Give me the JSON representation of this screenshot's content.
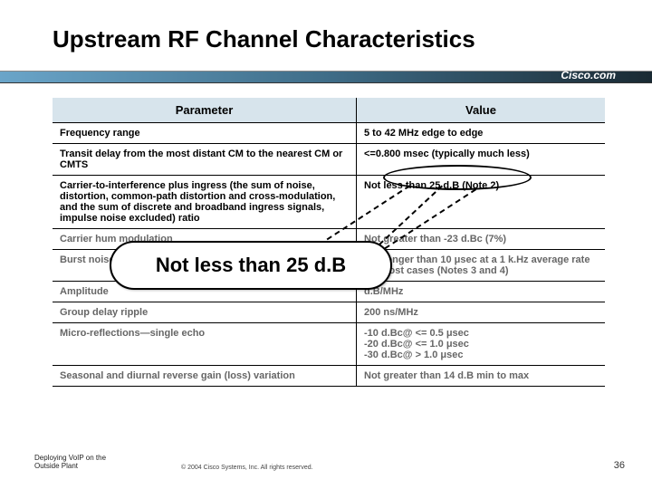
{
  "title": "Upstream RF Channel Characteristics",
  "brand": "Cisco.com",
  "table": {
    "headers": {
      "param": "Parameter",
      "value": "Value"
    },
    "rows": [
      {
        "param": "Frequency range",
        "value": "5 to 42 MHz edge to edge"
      },
      {
        "param": "Transit delay from the most distant CM to the nearest CM or CMTS",
        "value": "<=0.800 msec (typically much less)"
      },
      {
        "param": "Carrier-to-interference plus ingress (the sum of noise, distortion, common-path distortion and cross-modulation, and the sum of discrete and broadband ingress signals, impulse noise excluded) ratio",
        "value": "Not less than 25 d.B (Note 2)"
      },
      {
        "param": "Carrier hum modulation",
        "value": "Not greater than -23 d.Bc (7%)"
      },
      {
        "param": "Burst noise",
        "value": "Not longer than 10 μsec at a 1 k.Hz average rate for most cases (Notes 3 and 4)"
      },
      {
        "param": "Amplitude",
        "value": "d.B/MHz"
      },
      {
        "param": "Group delay ripple",
        "value": "200 ns/MHz"
      },
      {
        "param": "Micro-reflections—single echo",
        "value": "-10 d.Bc@ <= 0.5 μsec\n-20 d.Bc@ <= 1.0 μsec\n-30 d.Bc@ > 1.0 μsec"
      },
      {
        "param": "Seasonal and diurnal reverse gain (loss) variation",
        "value": "Not greater than 14 d.B min to max"
      }
    ]
  },
  "callout": "Not less than 25 d.B",
  "footer": {
    "line1": "Deploying VoIP on the",
    "line2": "Outside Plant"
  },
  "copyright": "© 2004 Cisco Systems, Inc. All rights reserved.",
  "page_number": "36"
}
